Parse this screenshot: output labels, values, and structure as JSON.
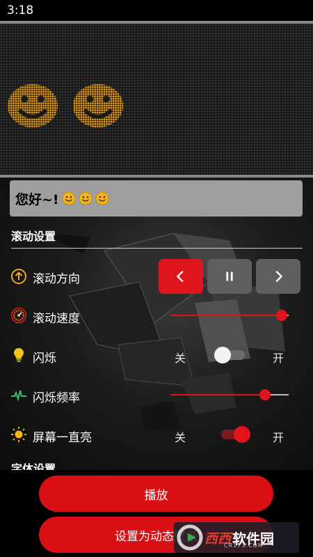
{
  "status_bar": {
    "time": "3:18"
  },
  "led_display": {
    "emoji_icons": [
      "smiley-face-icon",
      "smiley-face-icon"
    ],
    "led_color": "#f2a81f"
  },
  "message_input": {
    "value": "您好~!",
    "emoji_icons": [
      "smiley-face-icon",
      "smiley-face-icon",
      "smiley-face-icon"
    ]
  },
  "scroll_settings": {
    "title": "滚动设置",
    "direction": {
      "label": "滚动方向",
      "icon": "arrow-up-circle-icon",
      "buttons": [
        "chevron-left-icon",
        "pause-icon",
        "chevron-right-icon"
      ],
      "active": "chevron-left-icon"
    },
    "speed": {
      "label": "滚动速度",
      "icon": "speedometer-icon",
      "value": 0.94
    },
    "blink": {
      "label": "闪烁",
      "icon": "lightbulb-icon",
      "off_label": "关",
      "on_label": "开",
      "enabled": false
    },
    "blink_frequency": {
      "label": "闪烁频率",
      "icon": "pulse-wave-icon",
      "value": 0.8
    },
    "screen_on": {
      "label": "屏幕一直亮",
      "icon": "sun-icon",
      "off_label": "关",
      "on_label": "开",
      "enabled": true
    }
  },
  "font_settings": {
    "title": "字体设置"
  },
  "actions": {
    "play_label": "播放",
    "set_wallpaper_label": "设置为动态壁纸"
  },
  "watermark": {
    "brand": "西西",
    "brand_suffix": "软件园",
    "url": "CR173.COM"
  },
  "colors": {
    "accent": "#e0151b",
    "button": "#d90f14",
    "inactive": "#5f5f5f"
  }
}
